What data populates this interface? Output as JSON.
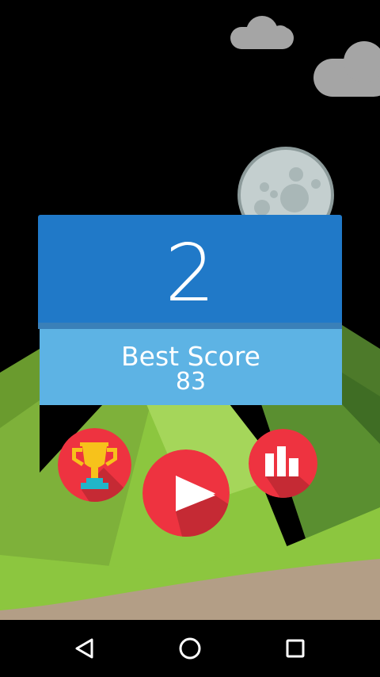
{
  "game": {
    "current_score": "2",
    "best_score_label": "Best Score",
    "best_score_value": "83"
  },
  "buttons": {
    "achievements_icon": "trophy-icon",
    "play_icon": "play-icon",
    "leaderboard_icon": "bar-chart-icon"
  },
  "navigation_bar": {
    "back_icon": "triangle-back-icon",
    "home_icon": "circle-home-icon",
    "recents_icon": "square-recents-icon"
  },
  "colors": {
    "score_panel": "#2079c8",
    "best_panel": "#5db3e4",
    "button_red": "#ee3340",
    "grass": "#8cc63f",
    "night_sky": "#000000"
  }
}
